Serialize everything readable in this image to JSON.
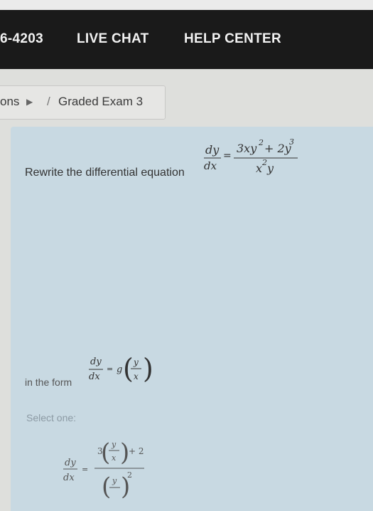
{
  "header": {
    "phone": "6-4203",
    "live_chat": "LIVE CHAT",
    "help_center": "HELP CENTER"
  },
  "breadcrumb": {
    "prefix": "ons",
    "separator": "/",
    "current": "Graded Exam 3"
  },
  "question": {
    "prompt": "Rewrite the differential equation",
    "equation": {
      "lhs_num": "dy",
      "lhs_den": "dx",
      "rhs_num_a": "3xy",
      "rhs_num_a_exp": "2",
      "rhs_num_b": "+ 2y",
      "rhs_num_b_exp": "3",
      "rhs_den": "x",
      "rhs_den_exp": "2",
      "rhs_den_b": "y"
    },
    "form_label": "in the form",
    "form_equation": {
      "num": "dy",
      "den": "dx",
      "g": "g",
      "inner_num": "y",
      "inner_den": "x"
    },
    "select_label": "Select one:",
    "option_a": {
      "lhs_num": "dy",
      "lhs_den": "dx",
      "coef": "3",
      "frac_num": "y",
      "frac_den": "x",
      "plus": "+ 2",
      "den_exp": "2"
    }
  },
  "colors": {
    "topbar": "#1a1a1a",
    "panel": "#c8d9e2",
    "background": "#dedfdc"
  }
}
